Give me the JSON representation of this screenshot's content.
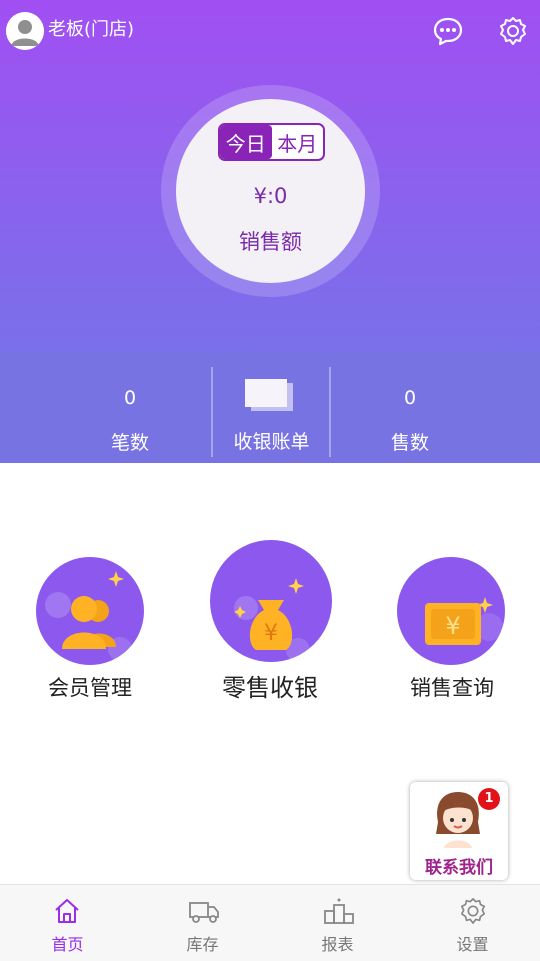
{
  "header": {
    "user_name": "老板(门店)",
    "icons": {
      "avatar": "user-avatar-icon",
      "chat": "chat-bubble-icon",
      "settings": "gear-icon"
    }
  },
  "sales_card": {
    "tabs": [
      "今日",
      "本月"
    ],
    "active_tab": "今日",
    "amount": "¥:0",
    "label": "销售额"
  },
  "stats": {
    "count": {
      "value": "0",
      "label": "笔数"
    },
    "receipts": {
      "label": "收银账单",
      "icon": "receipt-stack-icon"
    },
    "sales_qty": {
      "value": "0",
      "label": "售数"
    }
  },
  "functions": [
    {
      "label": "会员管理",
      "icon": "members-icon"
    },
    {
      "label": "零售收银",
      "icon": "money-bag-icon"
    },
    {
      "label": "销售查询",
      "icon": "yuan-ticket-icon"
    }
  ],
  "contact": {
    "label": "联系我们",
    "badge": "1",
    "icon": "customer-service-avatar-icon"
  },
  "bottom_nav": [
    {
      "label": "首页",
      "icon": "home-icon",
      "active": true
    },
    {
      "label": "库存",
      "icon": "truck-icon",
      "active": false
    },
    {
      "label": "报表",
      "icon": "podium-icon",
      "active": false
    },
    {
      "label": "设置",
      "icon": "gear-icon",
      "active": false
    }
  ],
  "colors": {
    "accent": "#9a2ee8",
    "header_top": "#a14ff2",
    "header_bottom": "#7a70ea",
    "stats_bar": "#7873e3"
  }
}
